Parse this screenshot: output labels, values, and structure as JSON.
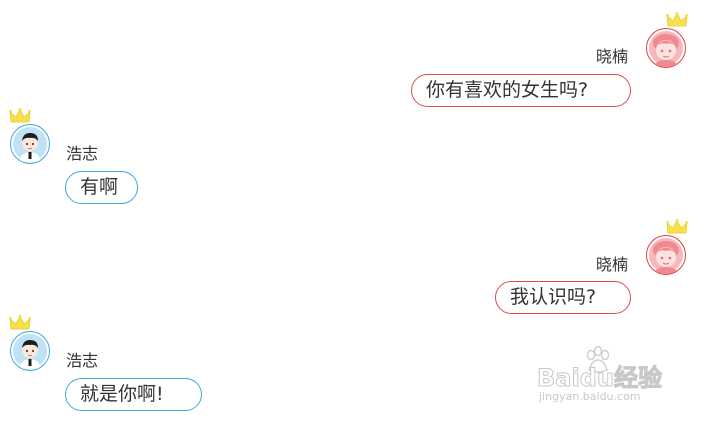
{
  "participants": {
    "female": {
      "name": "晓楠",
      "color": "#e24b4b",
      "avatar_icon": "girl-avatar-icon"
    },
    "male": {
      "name": "浩志",
      "color": "#3fa9d8",
      "avatar_icon": "boy-avatar-icon"
    }
  },
  "messages": [
    {
      "sender": "晓楠",
      "side": "right",
      "text": "你有喜欢的女生吗?"
    },
    {
      "sender": "浩志",
      "side": "left",
      "text": "有啊"
    },
    {
      "sender": "晓楠",
      "side": "right",
      "text": "我认识吗?"
    },
    {
      "sender": "浩志",
      "side": "left",
      "text": "就是你啊!"
    }
  ],
  "watermark": {
    "brand": "Baidu经验",
    "url": "jingyan.baidu.com"
  },
  "colors": {
    "crown": "#f7e14a",
    "female_border": "#e24b4b",
    "male_border": "#3fa9d8",
    "text": "#333333",
    "watermark": "#c8c8c8"
  }
}
